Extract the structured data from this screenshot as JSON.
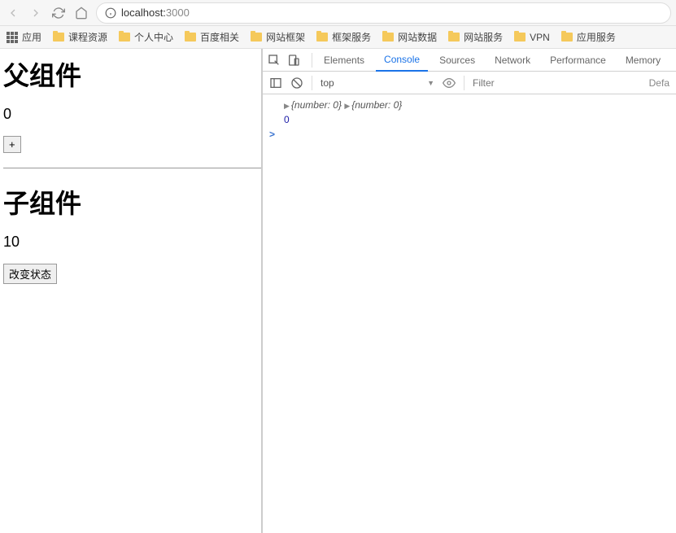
{
  "browser": {
    "url_host": "localhost:",
    "url_port": "3000",
    "apps_label": "应用",
    "bookmarks": [
      {
        "label": "课程资源"
      },
      {
        "label": "个人中心"
      },
      {
        "label": "百度相关"
      },
      {
        "label": "网站框架"
      },
      {
        "label": "框架服务"
      },
      {
        "label": "网站数据"
      },
      {
        "label": "网站服务"
      },
      {
        "label": "VPN"
      },
      {
        "label": "应用服务"
      }
    ]
  },
  "page": {
    "parent_title": "父组件",
    "parent_count": "0",
    "parent_btn": "+",
    "child_title": "子组件",
    "child_count": "10",
    "child_btn": "改变状态"
  },
  "devtools": {
    "tabs": {
      "elements": "Elements",
      "console": "Console",
      "sources": "Sources",
      "network": "Network",
      "performance": "Performance",
      "memory": "Memory"
    },
    "context": "top",
    "filter_placeholder": "Filter",
    "levels": "Defa",
    "console": {
      "line1_obj1": "{number: 0}",
      "line1_obj2": "{number: 0}",
      "line2": "0"
    }
  }
}
